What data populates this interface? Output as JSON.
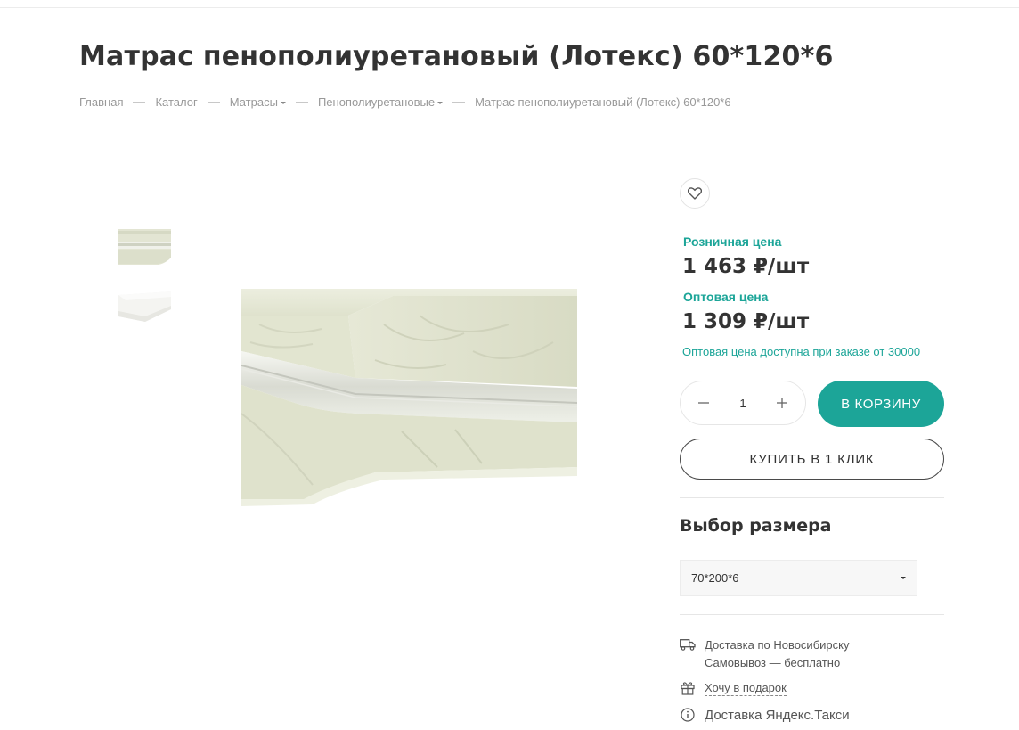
{
  "product": {
    "title": "Матрас пенополиуретановый (Лотекс) 60*120*6"
  },
  "breadcrumb": {
    "items": [
      "Главная",
      "Каталог",
      "Матрасы",
      "Пенополиуретановые"
    ],
    "current": "Матрас пенополиуретановый (Лотекс) 60*120*6"
  },
  "prices": {
    "retail_label": "Розничная цена",
    "retail_value": "1 463 ₽/шт",
    "wholesale_label": "Оптовая цена",
    "wholesale_value": "1 309 ₽/шт",
    "wholesale_note": "Оптовая цена доступна при заказе от 30000"
  },
  "quantity": {
    "value": "1",
    "minus_icon": "minus-icon",
    "plus_icon": "plus-icon"
  },
  "buttons": {
    "add_to_cart": "В КОРЗИНУ",
    "one_click": "КУПИТЬ В 1 КЛИК"
  },
  "size": {
    "title": "Выбор размера",
    "selected": "70*200*6"
  },
  "delivery": {
    "city_line": "Доставка по Новосибирску",
    "pickup_line": "Самовывоз — бесплатно",
    "gift_link": "Хочу в подарок",
    "taxi_line": "Доставка Яндекс.Такси"
  },
  "colors": {
    "accent": "#1ca598",
    "text": "#333333",
    "muted": "#999999"
  },
  "icons": {
    "favorite": "heart-icon",
    "delivery": "truck-icon",
    "gift": "gift-icon",
    "info": "info-icon"
  }
}
